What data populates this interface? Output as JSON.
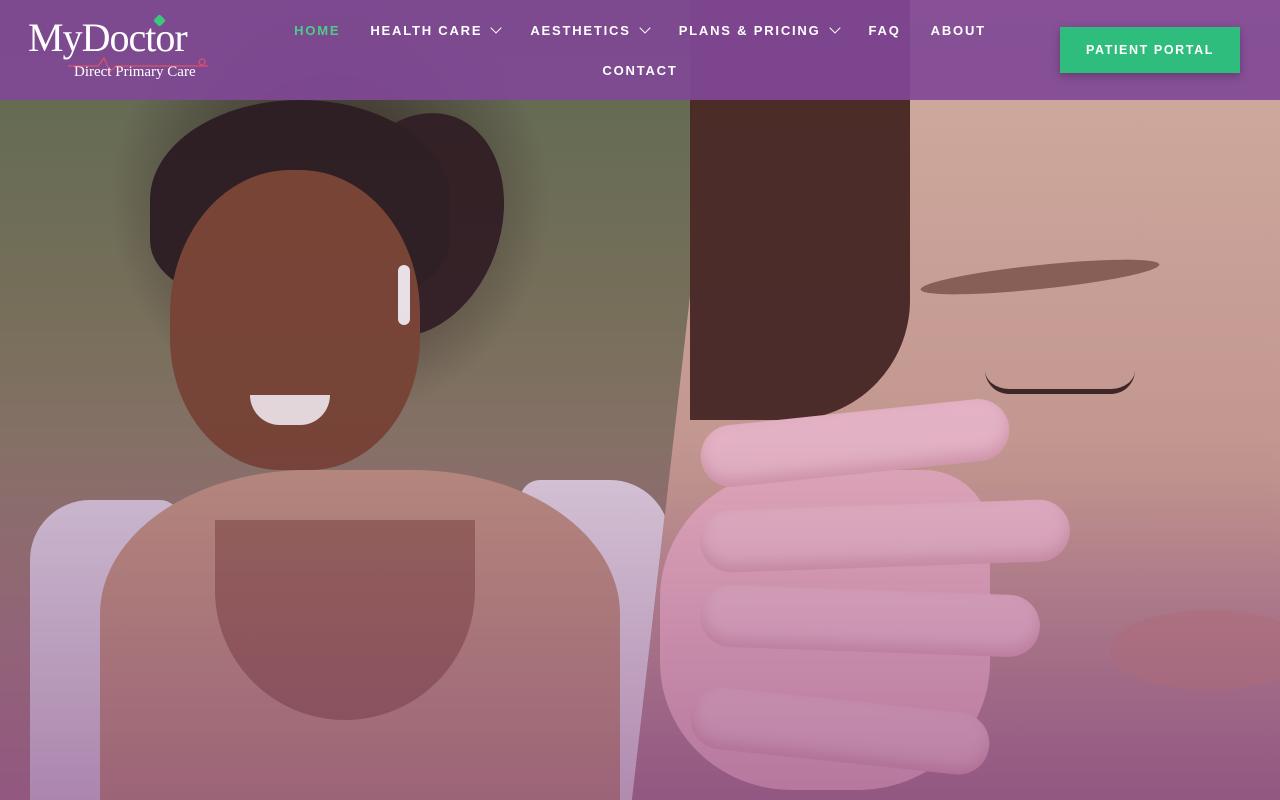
{
  "brand": {
    "logo_main": "MyDoctor",
    "logo_sub": "Direct Primary Care"
  },
  "nav": {
    "items": [
      {
        "label": "HOME",
        "active": true,
        "dropdown": false
      },
      {
        "label": "HEALTH CARE",
        "active": false,
        "dropdown": true
      },
      {
        "label": "AESTHETICS",
        "active": false,
        "dropdown": true
      },
      {
        "label": "PLANS & PRICING",
        "active": false,
        "dropdown": true
      },
      {
        "label": "FAQ",
        "active": false,
        "dropdown": false
      },
      {
        "label": "ABOUT",
        "active": false,
        "dropdown": false
      },
      {
        "label": "CONTACT",
        "active": false,
        "dropdown": false
      }
    ]
  },
  "header": {
    "portal_button": "PATIENT PORTAL"
  },
  "colors": {
    "header_bg": "#8048a0",
    "accent_green": "#2ebd7d",
    "active_nav": "#4ecb8a"
  }
}
